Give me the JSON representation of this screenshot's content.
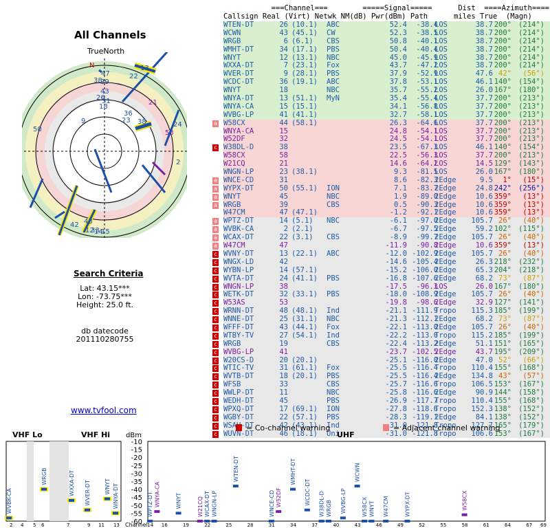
{
  "left_panel": {
    "title": "All Channels",
    "north_label": "TrueNorth",
    "compass_n": "N",
    "search_title": "Search Criteria",
    "lat": "Lat: 43.15***",
    "lon": "Lon: -73.75***",
    "height": "Height: 25.0 ft.",
    "db_label": "db datecode",
    "db_code": "201110280755",
    "link": "www.tvfool.com"
  },
  "table_header": {
    "line1": "           ===Channel===        =====Signal=====      Dist  ====Azimuth====",
    "line2": "Callsign Real (Virt) Netwk NM(dB) Pwr(dBm) Path      miles True  (Magn)"
  },
  "colors": {
    "green": "#d8f0d0",
    "yellow": "#f6f2bf",
    "pink": "#f8d6d6",
    "gray": "#e8e8e8"
  },
  "rows": [
    {
      "m": "",
      "bg": "green",
      "cs": "WTEN-DT",
      "real": "26",
      "virt": "(10.1)",
      "net": "ABC",
      "nm": "52.4",
      "pwr": "-38.4",
      "path": "LOS",
      "dist": "38.7",
      "true": "200°",
      "magn": "(214°)",
      "c": "#1f5aa6",
      "ac": "#1f7a3a"
    },
    {
      "m": "",
      "bg": "green",
      "cs": "WCWN",
      "real": "43",
      "virt": "(45.1)",
      "net": "CW",
      "nm": "52.3",
      "pwr": "-38.5",
      "path": "LOS",
      "dist": "38.7",
      "true": "200°",
      "magn": "(214°)",
      "c": "#1f5aa6",
      "ac": "#1f7a3a"
    },
    {
      "m": "",
      "bg": "green",
      "cs": "WRGB",
      "real": "6",
      "virt": "(6.1)",
      "net": "CBS",
      "nm": "50.8",
      "pwr": "-40.1",
      "path": "LOS",
      "dist": "38.7",
      "true": "200°",
      "magn": "(214°)",
      "c": "#1f5aa6",
      "ac": "#1f7a3a"
    },
    {
      "m": "",
      "bg": "green",
      "cs": "WMHT-DT",
      "real": "34",
      "virt": "(17.1)",
      "net": "PBS",
      "nm": "50.4",
      "pwr": "-40.4",
      "path": "LOS",
      "dist": "38.7",
      "true": "200°",
      "magn": "(214°)",
      "c": "#1f5aa6",
      "ac": "#1f7a3a"
    },
    {
      "m": "",
      "bg": "green",
      "cs": "WNYT",
      "real": "12",
      "virt": "(13.1)",
      "net": "NBC",
      "nm": "45.0",
      "pwr": "-45.9",
      "path": "LOS",
      "dist": "38.7",
      "true": "200°",
      "magn": "(214°)",
      "c": "#1f5aa6",
      "ac": "#1f7a3a"
    },
    {
      "m": "",
      "bg": "green",
      "cs": "WXXA-DT",
      "real": "7",
      "virt": "(23.1)",
      "net": "Fox",
      "nm": "43.7",
      "pwr": "-47.2",
      "path": "LOS",
      "dist": "38.7",
      "true": "200°",
      "magn": "(214°)",
      "c": "#1f5aa6",
      "ac": "#1f7a3a"
    },
    {
      "m": "",
      "bg": "green",
      "cs": "WVER-DT",
      "real": "9",
      "virt": "(28.1)",
      "net": "PBS",
      "nm": "37.9",
      "pwr": "-52.9",
      "path": "LOS",
      "dist": "47.6",
      "true": "42°",
      "magn": "(56°)",
      "c": "#1f5aa6",
      "ac": "#c8a000"
    },
    {
      "m": "",
      "bg": "green",
      "cs": "WCDC-DT",
      "real": "36",
      "virt": "(19.1)",
      "net": "ABC",
      "nm": "37.8",
      "pwr": "-53.1",
      "path": "LOS",
      "dist": "46.1",
      "true": "140°",
      "magn": "(154°)",
      "c": "#1f5aa6",
      "ac": "#1f7a3a"
    },
    {
      "m": "",
      "bg": "green",
      "cs": "WNYT",
      "real": "18",
      "virt": "",
      "net": "NBC",
      "nm": "35.7",
      "pwr": "-55.2",
      "path": "LOS",
      "dist": "26.0",
      "true": "167°",
      "magn": "(180°)",
      "c": "#1f5aa6",
      "ac": "#1f7a3a"
    },
    {
      "m": "",
      "bg": "green",
      "cs": "WNYA-DT",
      "real": "13",
      "virt": "(51.1)",
      "net": "MyN",
      "nm": "35.4",
      "pwr": "-55.4",
      "path": "LOS",
      "dist": "37.7",
      "true": "200°",
      "magn": "(213°)",
      "c": "#1f5aa6",
      "ac": "#1f7a3a"
    },
    {
      "m": "",
      "bg": "green",
      "cs": "WNYA-CA",
      "real": "15",
      "virt": "(15.1)",
      "net": "",
      "nm": "34.1",
      "pwr": "-56.8",
      "path": "LOS",
      "dist": "37.7",
      "true": "200°",
      "magn": "(213°)",
      "c": "#1f5aa6",
      "ac": "#1f7a3a"
    },
    {
      "m": "",
      "bg": "green",
      "cs": "WVBG-LP",
      "real": "41",
      "virt": "(41.1)",
      "net": "",
      "nm": "32.7",
      "pwr": "-58.1",
      "path": "LOS",
      "dist": "37.7",
      "true": "200°",
      "magn": "(213°)",
      "c": "#1f5aa6",
      "ac": "#1f7a3a"
    },
    {
      "m": "a",
      "bg": "pink",
      "cs": "W58CX",
      "real": "44",
      "virt": "(58.1)",
      "net": "",
      "nm": "26.3",
      "pwr": "-64.6",
      "path": "LOS",
      "dist": "37.7",
      "true": "200°",
      "magn": "(213°)",
      "c": "#1f5aa6",
      "ac": "#1f7a3a"
    },
    {
      "m": "",
      "bg": "pink",
      "cs": "WNYA-CA",
      "real": "15",
      "virt": "",
      "net": "",
      "nm": "24.8",
      "pwr": "-54.1",
      "path": "LOS",
      "dist": "37.7",
      "true": "200°",
      "magn": "(213°)",
      "c": "#7a1fa0",
      "ac": "#1f7a3a"
    },
    {
      "m": "",
      "bg": "pink",
      "cs": "W52DF",
      "real": "32",
      "virt": "",
      "net": "",
      "nm": "24.5",
      "pwr": "-54.1",
      "path": "LOS",
      "dist": "37.7",
      "true": "200°",
      "magn": "(213°)",
      "c": "#7a1fa0",
      "ac": "#1f7a3a"
    },
    {
      "m": "c",
      "bg": "pink",
      "cs": "W38DL-D",
      "real": "38",
      "virt": "",
      "net": "",
      "nm": "23.5",
      "pwr": "-67.3",
      "path": "LOS",
      "dist": "46.1",
      "true": "140°",
      "magn": "(154°)",
      "c": "#1f5aa6",
      "ac": "#1f7a3a"
    },
    {
      "m": "",
      "bg": "pink",
      "cs": "W58CX",
      "real": "58",
      "virt": "",
      "net": "",
      "nm": "22.5",
      "pwr": "-56.3",
      "path": "LOS",
      "dist": "37.7",
      "true": "200°",
      "magn": "(213°)",
      "c": "#7a1fa0",
      "ac": "#1f7a3a"
    },
    {
      "m": "",
      "bg": "pink",
      "cs": "W21CQ",
      "real": "21",
      "virt": "",
      "net": "",
      "nm": "14.6",
      "pwr": "-64.2",
      "path": "LOS",
      "dist": "14.5",
      "true": "129°",
      "magn": "(143°)",
      "c": "#7a1fa0",
      "ac": "#1f7a3a"
    },
    {
      "m": "",
      "bg": "pink",
      "cs": "WNGN-LP",
      "real": "23",
      "virt": "(38.1)",
      "net": "",
      "nm": "9.3",
      "pwr": "-81.5",
      "path": "LOS",
      "dist": "26.0",
      "true": "167°",
      "magn": "(180°)",
      "c": "#1f5aa6",
      "ac": "#1f7a3a"
    },
    {
      "m": "a",
      "bg": "pink",
      "cs": "WNCE-CD",
      "real": "31",
      "virt": "",
      "net": "",
      "nm": "8.6",
      "pwr": "-82.3",
      "path": "2Edge",
      "dist": "9.5",
      "true": "1°",
      "magn": "(15°)",
      "c": "#1f5aa6",
      "ac": "#c00000"
    },
    {
      "m": "a",
      "bg": "pink",
      "cs": "WYPX-DT",
      "real": "50",
      "virt": "(55.1)",
      "net": "ION",
      "nm": "7.1",
      "pwr": "-83.7",
      "path": "2Edge",
      "dist": "24.8",
      "true": "242°",
      "magn": "(256°)",
      "c": "#1f5aa6",
      "ac": "#1010a0"
    },
    {
      "m": "a",
      "bg": "pink",
      "cs": "WNYT",
      "real": "45",
      "virt": "",
      "net": "NBC",
      "nm": "1.9",
      "pwr": "-89.0",
      "path": "2Edge",
      "dist": "10.6",
      "true": "359°",
      "magn": "(13°)",
      "c": "#1f5aa6",
      "ac": "#c00000"
    },
    {
      "m": "a",
      "bg": "pink",
      "cs": "WRGB",
      "real": "39",
      "virt": "",
      "net": "CBS",
      "nm": "0.5",
      "pwr": "-90.3",
      "path": "2Edge",
      "dist": "10.6",
      "true": "359°",
      "magn": "(13°)",
      "c": "#1f5aa6",
      "ac": "#c00000"
    },
    {
      "m": "",
      "bg": "pink",
      "cs": "W47CM",
      "real": "47",
      "virt": "(47.1)",
      "net": "",
      "nm": "-1.2",
      "pwr": "-92.1",
      "path": "2Edge",
      "dist": "10.6",
      "true": "359°",
      "magn": "(13°)",
      "c": "#1f5aa6",
      "ac": "#c00000"
    },
    {
      "m": "a",
      "bg": "gray",
      "cs": "WPTZ-DT",
      "real": "14",
      "virt": "(5.1)",
      "net": "NBC",
      "nm": "-6.1",
      "pwr": "-97.0",
      "path": "2Edge",
      "dist": "105.7",
      "true": "26°",
      "magn": "(40°)",
      "c": "#1f5aa6",
      "ac": "#c86400"
    },
    {
      "m": "a",
      "bg": "gray",
      "cs": "WVBK-CA",
      "real": "2",
      "virt": "(2.1)",
      "net": "",
      "nm": "-6.7",
      "pwr": "-97.5",
      "path": "2Edge",
      "dist": "59.2",
      "true": "102°",
      "magn": "(115°)",
      "c": "#1f5aa6",
      "ac": "#1f7a3a"
    },
    {
      "m": "a",
      "bg": "gray",
      "cs": "WCAX-DT",
      "real": "22",
      "virt": "(3.1)",
      "net": "CBS",
      "nm": "-8.9",
      "pwr": "-99.7",
      "path": "2Edge",
      "dist": "105.7",
      "true": "26°",
      "magn": "(40°)",
      "c": "#1f5aa6",
      "ac": "#c86400"
    },
    {
      "m": "a",
      "bg": "gray",
      "cs": "W47CM",
      "real": "47",
      "virt": "",
      "net": "",
      "nm": "-11.9",
      "pwr": "-90.8",
      "path": "2Edge",
      "dist": "10.6",
      "true": "359°",
      "magn": "(13°)",
      "c": "#7a1fa0",
      "ac": "#c00000"
    },
    {
      "m": "c",
      "bg": "gray",
      "cs": "WVNY-DT",
      "real": "13",
      "virt": "(22.1)",
      "net": "ABC",
      "nm": "-12.0",
      "pwr": "-102.9",
      "path": "2Edge",
      "dist": "105.7",
      "true": "26°",
      "magn": "(40°)",
      "c": "#1f5aa6",
      "ac": "#c86400"
    },
    {
      "m": "c",
      "bg": "gray",
      "cs": "WNGX-LD",
      "real": "42",
      "virt": "",
      "net": "",
      "nm": "-14.6",
      "pwr": "-105.4",
      "path": "2Edge",
      "dist": "26.3",
      "true": "218°",
      "magn": "(232°)",
      "c": "#1f5aa6",
      "ac": "#1f7a3a"
    },
    {
      "m": "c",
      "bg": "gray",
      "cs": "WYBN-LP",
      "real": "14",
      "virt": "(57.1)",
      "net": "",
      "nm": "-15.2",
      "pwr": "-106.0",
      "path": "2Edge",
      "dist": "65.3",
      "true": "204°",
      "magn": "(218°)",
      "c": "#1f5aa6",
      "ac": "#1f7a3a"
    },
    {
      "m": "c",
      "bg": "gray",
      "cs": "WVTA-DT",
      "real": "24",
      "virt": "(41.1)",
      "net": "PBS",
      "nm": "-16.8",
      "pwr": "-107.6",
      "path": "2Edge",
      "dist": "68.2",
      "true": "73°",
      "magn": "(87°)",
      "c": "#1f5aa6",
      "ac": "#c8a000"
    },
    {
      "m": "c",
      "bg": "gray",
      "cs": "WNGN-LP",
      "real": "38",
      "virt": "",
      "net": "",
      "nm": "-17.5",
      "pwr": "-96.3",
      "path": "LOS",
      "dist": "26.0",
      "true": "167°",
      "magn": "(180°)",
      "c": "#7a1fa0",
      "ac": "#1f7a3a"
    },
    {
      "m": "c",
      "bg": "gray",
      "cs": "WETK-DT",
      "real": "32",
      "virt": "(33.1)",
      "net": "PBS",
      "nm": "-18.0",
      "pwr": "-108.9",
      "path": "2Edge",
      "dist": "105.7",
      "true": "26°",
      "magn": "(40°)",
      "c": "#1f5aa6",
      "ac": "#c86400"
    },
    {
      "m": "c",
      "bg": "gray",
      "cs": "W53AS",
      "real": "53",
      "virt": "",
      "net": "",
      "nm": "-19.8",
      "pwr": "-98.6",
      "path": "2Edge",
      "dist": "32.9",
      "true": "127°",
      "magn": "(141°)",
      "c": "#7a1fa0",
      "ac": "#1f7a3a"
    },
    {
      "m": "c",
      "bg": "gray",
      "cs": "WRNN-DT",
      "real": "48",
      "virt": "(48.1)",
      "net": "Ind",
      "nm": "-21.1",
      "pwr": "-111.9",
      "path": "Tropo",
      "dist": "115.3",
      "true": "185°",
      "magn": "(199°)",
      "c": "#1f5aa6",
      "ac": "#1f7a3a"
    },
    {
      "m": "c",
      "bg": "gray",
      "cs": "WNNE-DT",
      "real": "25",
      "virt": "(31.1)",
      "net": "NBC",
      "nm": "-21.3",
      "pwr": "-112.1",
      "path": "2Edge",
      "dist": "68.2",
      "true": "73°",
      "magn": "(87°)",
      "c": "#1f5aa6",
      "ac": "#c8a000"
    },
    {
      "m": "c",
      "bg": "gray",
      "cs": "WFFF-DT",
      "real": "43",
      "virt": "(44.1)",
      "net": "Fox",
      "nm": "-22.1",
      "pwr": "-113.0",
      "path": "2Edge",
      "dist": "105.7",
      "true": "26°",
      "magn": "(40°)",
      "c": "#1f5aa6",
      "ac": "#c86400"
    },
    {
      "m": "c",
      "bg": "gray",
      "cs": "WTBY-TV",
      "real": "27",
      "virt": "(54.1)",
      "net": "Ind",
      "nm": "-22.2",
      "pwr": "-113.0",
      "path": "Tropo",
      "dist": "115.2",
      "true": "185°",
      "magn": "(199°)",
      "c": "#1f5aa6",
      "ac": "#1f7a3a"
    },
    {
      "m": "c",
      "bg": "gray",
      "cs": "WRGB",
      "real": "19",
      "virt": "",
      "net": "CBS",
      "nm": "-22.4",
      "pwr": "-113.2",
      "path": "2Edge",
      "dist": "51.1",
      "true": "151°",
      "magn": "(165°)",
      "c": "#1f5aa6",
      "ac": "#1f7a3a"
    },
    {
      "m": "c",
      "bg": "gray",
      "cs": "WVBG-LP",
      "real": "41",
      "virt": "",
      "net": "",
      "nm": "-23.7",
      "pwr": "-102.5",
      "path": "2Edge",
      "dist": "43.7",
      "true": "195°",
      "magn": "(209°)",
      "c": "#7a1fa0",
      "ac": "#1f7a3a"
    },
    {
      "m": "c",
      "bg": "gray",
      "cs": "W20CS-D",
      "real": "20",
      "virt": "(20.1)",
      "net": "",
      "nm": "-25.1",
      "pwr": "-116.0",
      "path": "2Edge",
      "dist": "47.0",
      "true": "52°",
      "magn": "(66°)",
      "c": "#1f5aa6",
      "ac": "#c8a000"
    },
    {
      "m": "c",
      "bg": "gray",
      "cs": "WTIC-TV",
      "real": "31",
      "virt": "(61.1)",
      "net": "Fox",
      "nm": "-25.5",
      "pwr": "-116.4",
      "path": "Tropo",
      "dist": "110.4",
      "true": "155°",
      "magn": "(168°)",
      "c": "#1f5aa6",
      "ac": "#1f7a3a"
    },
    {
      "m": "c",
      "bg": "gray",
      "cs": "WVTB-DT",
      "real": "18",
      "virt": "(20.1)",
      "net": "PBS",
      "nm": "-25.5",
      "pwr": "-116.4",
      "path": "2Edge",
      "dist": "134.8",
      "true": "43°",
      "magn": "(57°)",
      "c": "#1f5aa6",
      "ac": "#c86400"
    },
    {
      "m": "c",
      "bg": "gray",
      "cs": "WFSB",
      "real": "33",
      "virt": "",
      "net": "CBS",
      "nm": "-25.7",
      "pwr": "-116.6",
      "path": "Tropo",
      "dist": "106.5",
      "true": "153°",
      "magn": "(167°)",
      "c": "#1f5aa6",
      "ac": "#1f7a3a"
    },
    {
      "m": "c",
      "bg": "gray",
      "cs": "WWLP-DT",
      "real": "11",
      "virt": "",
      "net": "NBC",
      "nm": "-25.8",
      "pwr": "-116.6",
      "path": "2Edge",
      "dist": "90.9",
      "true": "144°",
      "magn": "(158°)",
      "c": "#1f5aa6",
      "ac": "#1f7a3a"
    },
    {
      "m": "c",
      "bg": "gray",
      "cs": "WEDH-DT",
      "real": "45",
      "virt": "",
      "net": "PBS",
      "nm": "-26.9",
      "pwr": "-117.7",
      "path": "Tropo",
      "dist": "110.4",
      "true": "155°",
      "magn": "(168°)",
      "c": "#1f5aa6",
      "ac": "#1f7a3a"
    },
    {
      "m": "c",
      "bg": "gray",
      "cs": "WPXQ-DT",
      "real": "17",
      "virt": "(69.1)",
      "net": "ION",
      "nm": "-27.8",
      "pwr": "-118.6",
      "path": "Tropo",
      "dist": "152.3",
      "true": "138°",
      "magn": "(152°)",
      "c": "#1f5aa6",
      "ac": "#1f7a3a"
    },
    {
      "m": "c",
      "bg": "gray",
      "cs": "WGBY-DT",
      "real": "22",
      "virt": "(57.1)",
      "net": "PBS",
      "nm": "-28.3",
      "pwr": "-119.1",
      "path": "2Edge",
      "dist": "84.1",
      "true": "138°",
      "magn": "(152°)",
      "c": "#1f5aa6",
      "ac": "#1f7a3a"
    },
    {
      "m": "c",
      "bg": "gray",
      "cs": "WSAH-DT",
      "real": "42",
      "virt": "(43.1)",
      "net": "Ind",
      "nm": "-31.0",
      "pwr": "-121.8",
      "path": "Tropo",
      "dist": "127.7",
      "true": "165°",
      "magn": "(179°)",
      "c": "#1f5aa6",
      "ac": "#1f7a3a"
    },
    {
      "m": "c",
      "bg": "gray",
      "cs": "WUVN-DT",
      "real": "46",
      "virt": "(18.1)",
      "net": "Uni",
      "nm": "-31.0",
      "pwr": "-121.8",
      "path": "Tropo",
      "dist": "106.6",
      "true": "153°",
      "magn": "(167°)",
      "c": "#1f5aa6",
      "ac": "#1f7a3a"
    }
  ],
  "radar_labels": [
    "47",
    "39",
    "43",
    "31",
    "13",
    "22",
    "9",
    "24",
    "2",
    "50",
    "26",
    "18",
    "36",
    "38",
    "21",
    "53",
    "23",
    "38",
    "42",
    "43",
    "12",
    "14",
    "15",
    "33"
  ],
  "bottom": {
    "vhf_lo": "VHF Lo",
    "vhf_hi": "VHF Hi",
    "dbm_label": "dBm",
    "uhf": "UHF",
    "co_channel": "= Co-channel warning",
    "adjacent": "= Adjacent channel warning",
    "channel_label": "Channel",
    "y_ticks": [
      "-10",
      "-15",
      "-20",
      "-25",
      "-30",
      "-35",
      "-40",
      "-45",
      "-50",
      "-55",
      "-60"
    ],
    "vhf_channels": [
      "2",
      "4",
      "5",
      "6",
      "7",
      "9",
      "11",
      "13"
    ],
    "uhf_channels": [
      "14",
      "16",
      "19",
      "22",
      "25",
      "28",
      "31",
      "34",
      "37",
      "40",
      "43",
      "46",
      "49",
      "52",
      "55",
      "58",
      "61",
      "64",
      "67",
      "69"
    ]
  },
  "chart_data": {
    "type": "bar",
    "title": "",
    "ylabel": "dBm",
    "ylim": [
      -60,
      -10
    ],
    "stations": [
      {
        "name": "WVBK-CA",
        "ch": 2,
        "dbm": -58
      },
      {
        "name": "WRGB",
        "ch": 6,
        "dbm": -40
      },
      {
        "name": "WXXA-DT",
        "ch": 7,
        "dbm": -47
      },
      {
        "name": "WVER-DT",
        "ch": 9,
        "dbm": -53
      },
      {
        "name": "WNYT",
        "ch": 12,
        "dbm": -46
      },
      {
        "name": "WNYA-DT",
        "ch": 13,
        "dbm": -55
      },
      {
        "name": "WPTZ-DT",
        "ch": 14,
        "dbm": -97
      },
      {
        "name": "WNYA-CA",
        "ch": 15,
        "dbm": -54
      },
      {
        "name": "WNYT",
        "ch": 18,
        "dbm": -55
      },
      {
        "name": "W21CQ",
        "ch": 21,
        "dbm": -64
      },
      {
        "name": "WCAX-DT",
        "ch": 22,
        "dbm": -99
      },
      {
        "name": "WNGN-LP",
        "ch": 23,
        "dbm": -81
      },
      {
        "name": "WTEN-DT",
        "ch": 26,
        "dbm": -38
      },
      {
        "name": "WNCE-CD",
        "ch": 31,
        "dbm": -82
      },
      {
        "name": "W52DF",
        "ch": 32,
        "dbm": -54
      },
      {
        "name": "WMHT-DT",
        "ch": 34,
        "dbm": -40
      },
      {
        "name": "WCDC-DT",
        "ch": 36,
        "dbm": -53
      },
      {
        "name": "W38DL-D",
        "ch": 38,
        "dbm": -67
      },
      {
        "name": "WRGB",
        "ch": 39,
        "dbm": -90
      },
      {
        "name": "WVBG-LP",
        "ch": 41,
        "dbm": -58
      },
      {
        "name": "WCWN",
        "ch": 43,
        "dbm": -38
      },
      {
        "name": "W58CX",
        "ch": 44,
        "dbm": -64
      },
      {
        "name": "WNYT",
        "ch": 45,
        "dbm": -89
      },
      {
        "name": "W47CM",
        "ch": 47,
        "dbm": -92
      },
      {
        "name": "WYPX-DT",
        "ch": 50,
        "dbm": -83
      },
      {
        "name": "W58CX",
        "ch": 58,
        "dbm": -56
      }
    ]
  }
}
